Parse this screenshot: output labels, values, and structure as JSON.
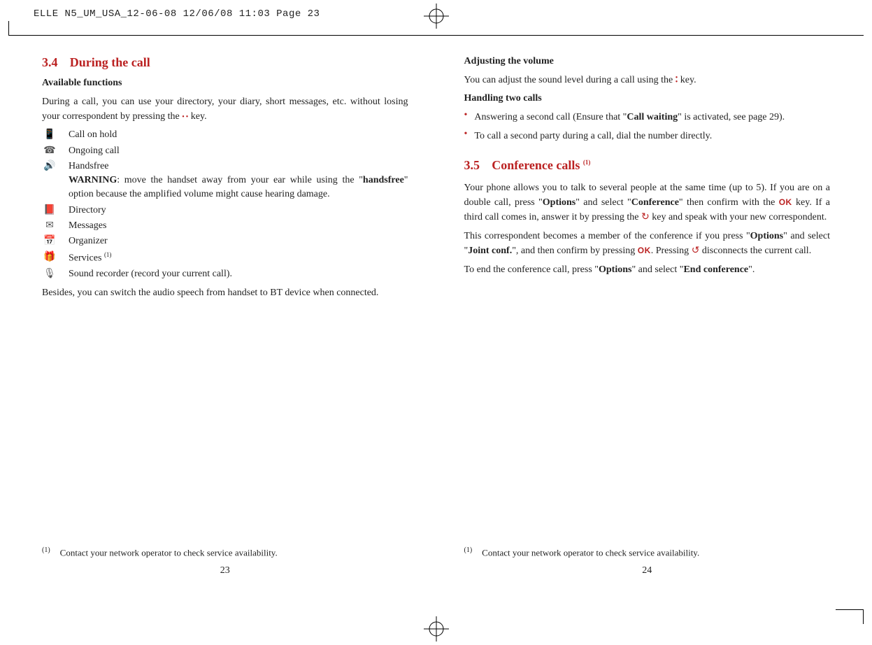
{
  "header": "ELLE N5_UM_USA_12-06-08  12/06/08  11:03  Page 23",
  "left": {
    "section_num": "3.4",
    "section_title": "During the call",
    "sub1": "Available functions",
    "intro_a": "During a call, you can use your directory, your diary, short messages, etc. without losing your correspondent by pressing the ",
    "intro_b": " key.",
    "funcs": {
      "hold": "Call on hold",
      "ongoing": "Ongoing call",
      "hands": "Handsfree",
      "warn_label": "WARNING",
      "warn_text": ": move the handset away from your ear while using the \"",
      "warn_bold": "handsfree",
      "warn_text2": "\" option because the amplified volume might cause hearing damage.",
      "dir": "Directory",
      "msg": "Messages",
      "org": "Organizer",
      "serv": "Services ",
      "serv_sup": "(1)",
      "rec": "Sound recorder (record your current call)."
    },
    "besides": "Besides, you can switch the audio speech from handset to BT device when connected.",
    "foot_sup": "(1)",
    "foot": "Contact your network operator to check service availability.",
    "pagenum": "23"
  },
  "right": {
    "sub_vol": "Adjusting the volume",
    "vol_a": "You can adjust the sound level during a call using the ",
    "vol_b": " key.",
    "sub_two": "Handling two calls",
    "b1_a": "Answering a second call (Ensure that \"",
    "b1_bold": "Call waiting",
    "b1_b": "\" is activated, see page 29).",
    "b2": "To call a second party during a call, dial the number directly.",
    "section_num": "3.5",
    "section_title": "Conference calls ",
    "section_sup": "(1)",
    "p1_a": "Your phone allows you to talk to several people at the same time (up to 5). If you are on a double call, press \"",
    "p1_b1": "Options",
    "p1_c": "\" and select \"",
    "p1_b2": "Conference",
    "p1_d": "\" then confirm with the ",
    "p1_e": " key. If a third call comes in, answer it by pressing the ",
    "p1_f": " key and speak with your new correspondent.",
    "p2_a": "This correspondent becomes a member of the conference if you press \"",
    "p2_b1": "Options",
    "p2_b": "\" and select \"",
    "p2_b2": "Joint conf.",
    "p2_c": "\", and then confirm by pressing ",
    "p2_d": ". Pressing ",
    "p2_e": " disconnects the current call.",
    "p3_a": "To end the conference call, press \"",
    "p3_b1": "Options",
    "p3_b": "\" and select \"",
    "p3_b2": "End conference",
    "p3_c": "\".",
    "foot_sup": "(1)",
    "foot": "Contact your network operator to check service availability.",
    "pagenum": "24"
  }
}
